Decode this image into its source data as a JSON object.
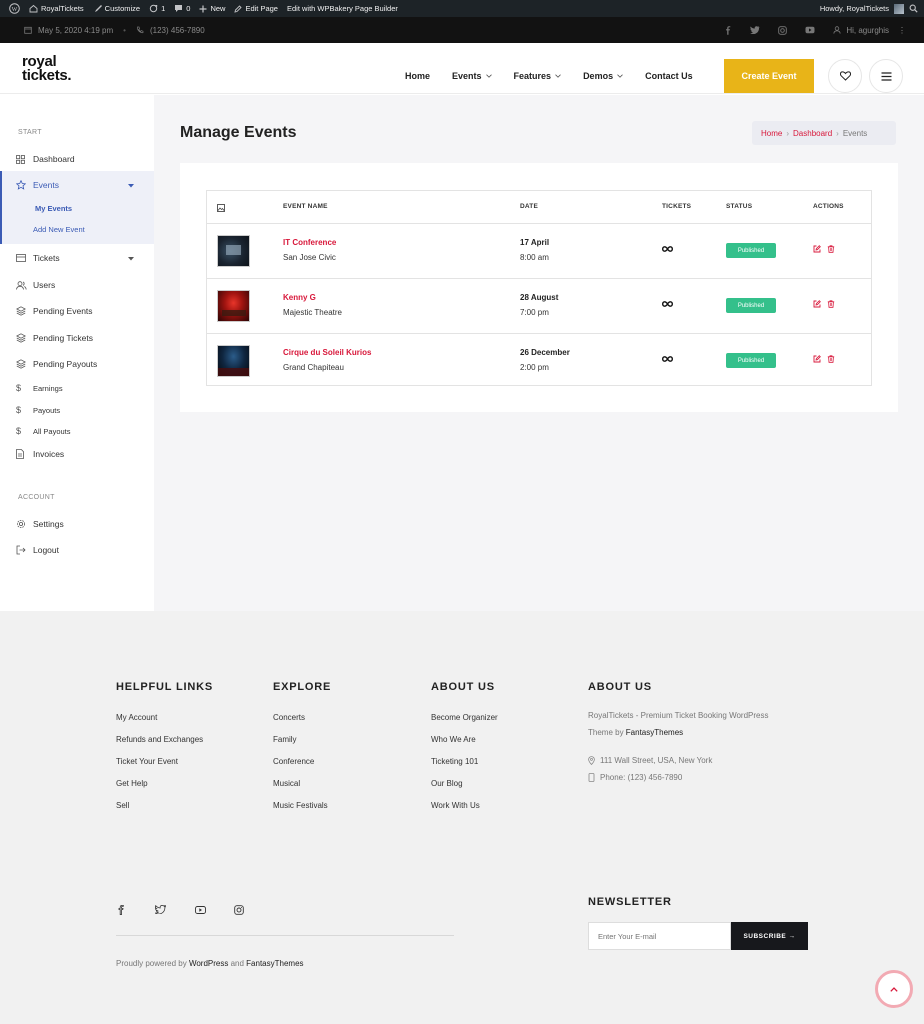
{
  "adminbar": {
    "site": "RoyalTickets",
    "customize": "Customize",
    "updates": "1",
    "comments": "0",
    "new": "New",
    "edit_page": "Edit Page",
    "wpbakery": "Edit with WPBakery Page Builder",
    "howdy": "Howdy, RoyalTickets"
  },
  "topbar": {
    "date": "May 5, 2020 4:19 pm",
    "phone": "(123) 456-7890",
    "user": "Hi, agurghis"
  },
  "header": {
    "logo_line1": "royal",
    "logo_line2": "tickets.",
    "nav": [
      "Home",
      "Events",
      "Features",
      "Demos",
      "Contact Us"
    ],
    "create_event": "Create Event"
  },
  "sidebar": {
    "start_heading": "START",
    "dashboard": "Dashboard",
    "events": "Events",
    "my_events": "My Events",
    "add_new_event": "Add New Event",
    "tickets": "Tickets",
    "users": "Users",
    "pending_events": "Pending Events",
    "pending_tickets": "Pending Tickets",
    "pending_payouts": "Pending Payouts",
    "earnings": "Earnings",
    "payouts": "Payouts",
    "all_payouts": "All Payouts",
    "invoices": "Invoices",
    "account_heading": "ACCOUNT",
    "settings": "Settings",
    "logout": "Logout"
  },
  "main": {
    "title": "Manage Events",
    "breadcrumb": {
      "home": "Home",
      "dashboard": "Dashboard",
      "current": "Events",
      "sep": "›"
    },
    "table": {
      "headers": {
        "name": "EVENT NAME",
        "date": "DATE",
        "tickets": "TICKETS",
        "status": "STATUS",
        "actions": "ACTIONS"
      },
      "rows": [
        {
          "name": "IT Conference",
          "venue": "San Jose Civic",
          "date": "17 April",
          "time": "8:00 am",
          "status": "Published"
        },
        {
          "name": "Kenny G",
          "venue": "Majestic Theatre",
          "date": "28 August",
          "time": "7:00 pm",
          "status": "Published"
        },
        {
          "name": "Cirque du Soleil Kurios",
          "venue": "Grand Chapiteau",
          "date": "26 December",
          "time": "2:00 pm",
          "status": "Published"
        }
      ]
    }
  },
  "footer": {
    "helpful": {
      "heading": "HELPFUL LINKS",
      "links": [
        "My Account",
        "Refunds and Exchanges",
        "Ticket Your Event",
        "Get Help",
        "Sell"
      ]
    },
    "explore": {
      "heading": "EXPLORE",
      "links": [
        "Concerts",
        "Family",
        "Conference",
        "Musical",
        "Music Festivals"
      ]
    },
    "about1": {
      "heading": "ABOUT US",
      "links": [
        "Become Organizer",
        "Who We Are",
        "Ticketing 101",
        "Our Blog",
        "Work With Us"
      ]
    },
    "about2": {
      "heading": "ABOUT US",
      "desc_line1": "RoyalTickets - Premium Ticket Booking WordPress",
      "desc_line2_pre": "Theme by ",
      "desc_line2_brand": "FantasyThemes",
      "address": "111 Wall Street, USA, New York",
      "phone": "Phone: (123) 456-7890"
    },
    "newsletter": {
      "heading": "NEWSLETTER",
      "placeholder": "Enter Your E-mail",
      "button": "SUBSCRIBE →"
    },
    "powered": {
      "pre": "Proudly powered by ",
      "wp": "WordPress",
      "and": " and ",
      "ft": "FantasyThemes"
    }
  },
  "colors": {
    "accent": "#d8173a",
    "create_button": "#e8b418",
    "published": "#34c08b",
    "sidebar_active": "#3b5bb5"
  }
}
